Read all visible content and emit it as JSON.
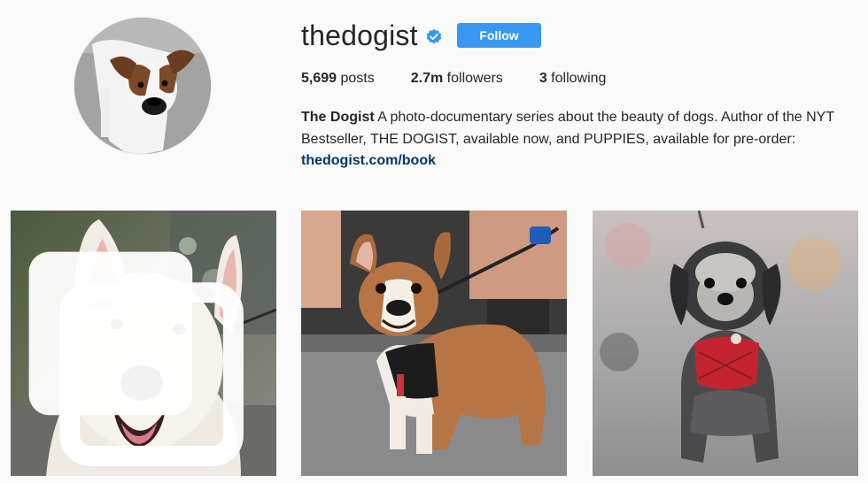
{
  "profile": {
    "username": "thedogist",
    "verified": true,
    "follow_label": "Follow",
    "accent_color": "#3897f0",
    "avatar_icon": "profile-photo-boxer-dog"
  },
  "stats": {
    "posts_count": "5,699",
    "posts_label": "posts",
    "followers_count": "2.7m",
    "followers_label": "followers",
    "following_count": "3",
    "following_label": "following"
  },
  "bio": {
    "name": "The Dogist",
    "text": "A photo-documentary series about the beauty of dogs. Author of the NYT Bestseller, THE DOGIST, available now, and PUPPIES, available for pre-order:",
    "link": "thedogist.com/book"
  },
  "posts": [
    {
      "subject": "white-shepherd-dog-photo",
      "multiple_icon": "carousel-icon"
    },
    {
      "subject": "french-bulldog-photo"
    },
    {
      "subject": "shih-tzu-mix-photo"
    }
  ]
}
